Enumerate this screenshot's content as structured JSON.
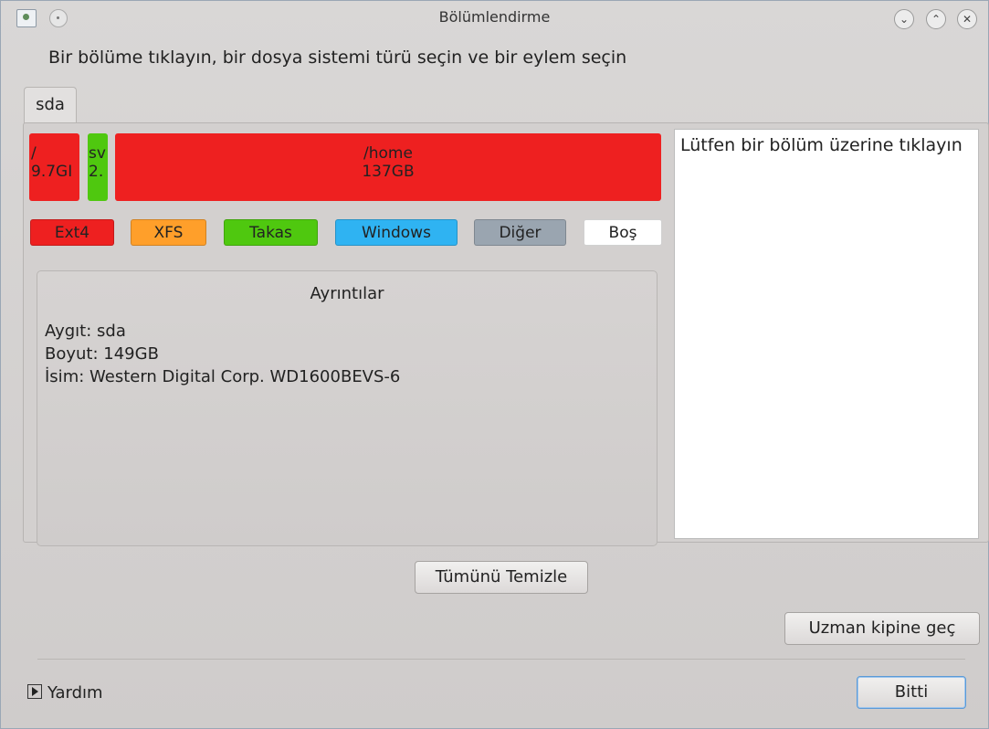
{
  "window": {
    "title": "Bölümlendirme",
    "controls": [
      "⌄",
      "⌃",
      "✕"
    ]
  },
  "instruction": "Bir bölüme tıklayın, bir dosya sistemi türü seçin ve bir eylem seçin",
  "tabs": [
    {
      "label": "sda"
    }
  ],
  "partitions": [
    {
      "mount": "/",
      "size": "9.7GI",
      "color": "#ee2020"
    },
    {
      "mount": "sv",
      "size": "2.",
      "color": "#4fc80f"
    },
    {
      "mount": "/home",
      "size": "137GB",
      "color": "#ee2020"
    }
  ],
  "legend": [
    {
      "label": "Ext4",
      "color": "#ee2020"
    },
    {
      "label": "XFS",
      "color": "#ff9f2a"
    },
    {
      "label": "Takas",
      "color": "#4fc80f"
    },
    {
      "label": "Windows",
      "color": "#2fb3f2"
    },
    {
      "label": "Diğer",
      "color": "#9aa5b0"
    },
    {
      "label": "Boş",
      "color": "#ffffff"
    }
  ],
  "details": {
    "title": "Ayrıntılar",
    "lines": [
      "Aygıt: sda",
      "Boyut: 149GB",
      "İsim: Western Digital Corp. WD1600BEVS-6"
    ]
  },
  "infobox": "Lütfen bir bölüm üzerine tıklayın",
  "buttons": {
    "clear_all": "Tümünü Temizle",
    "expert_mode": "Uzman kipine geç",
    "done": "Bitti"
  },
  "help": "Yardım"
}
